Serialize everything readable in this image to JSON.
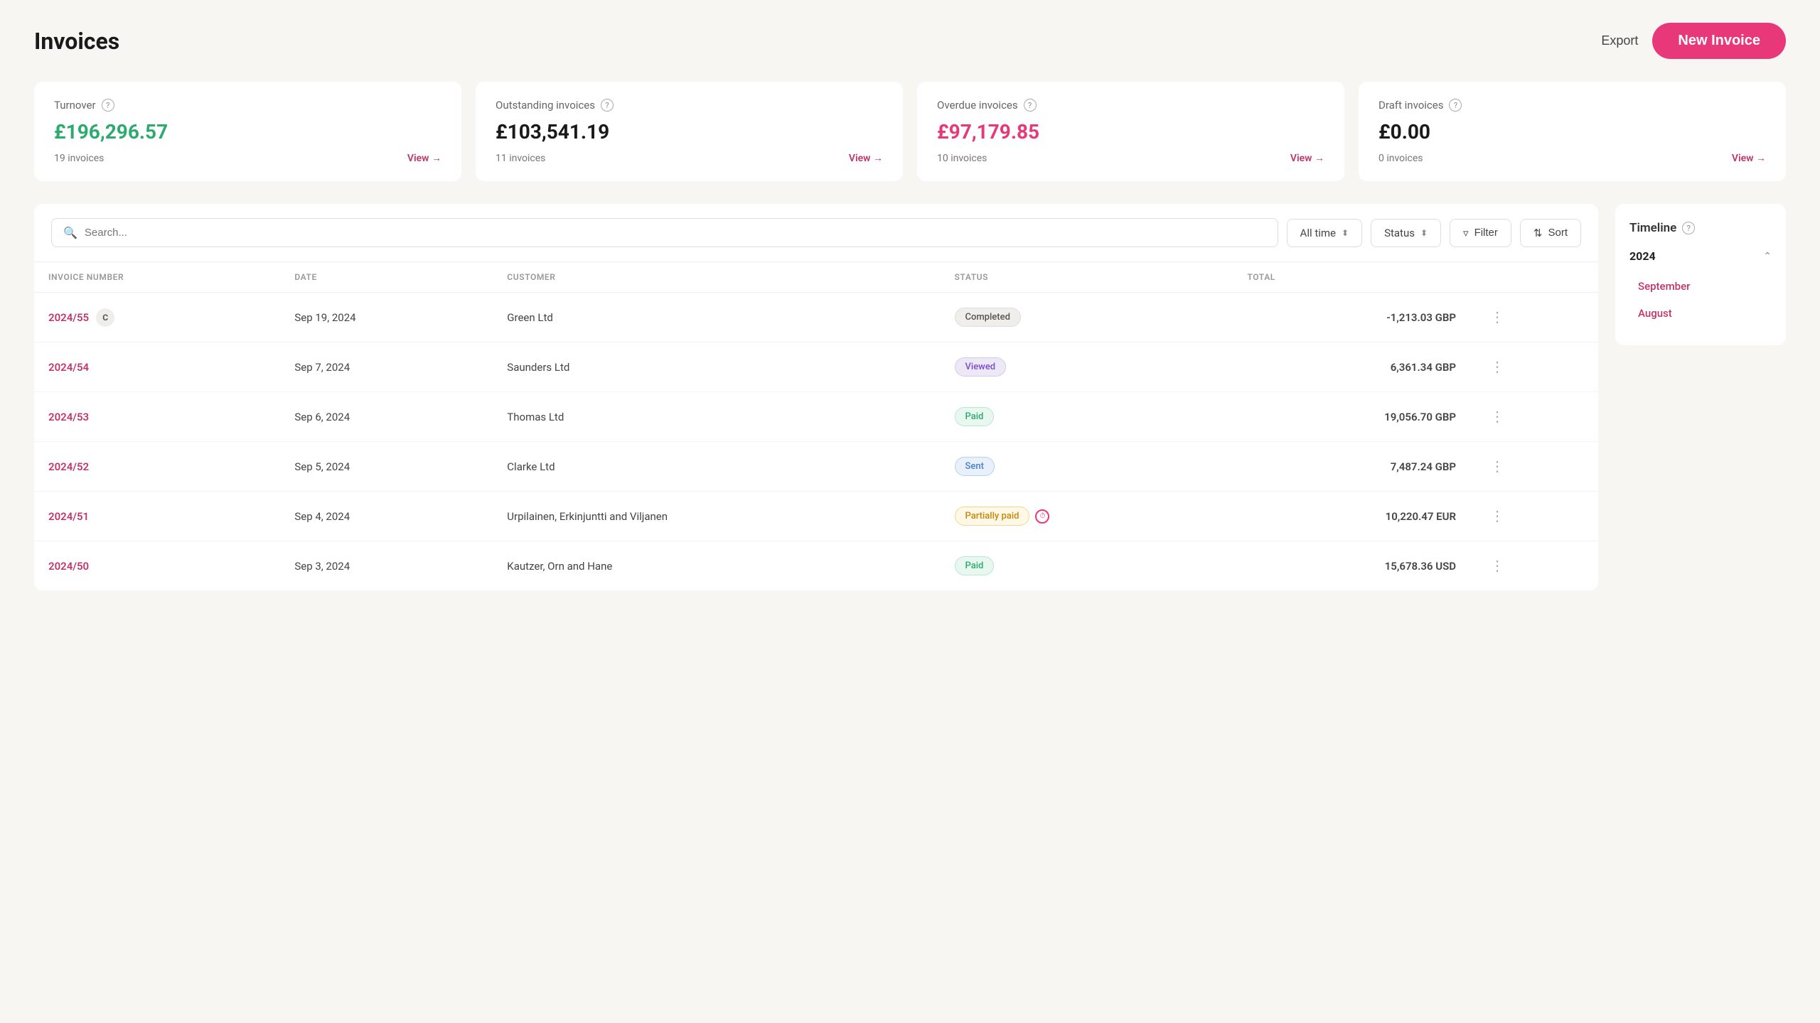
{
  "page": {
    "title": "Invoices"
  },
  "header": {
    "export_label": "Export",
    "new_invoice_label": "New Invoice"
  },
  "summary_cards": [
    {
      "label": "Turnover",
      "amount": "£196,296.57",
      "amount_style": "green",
      "count": "19 invoices",
      "link": "View →"
    },
    {
      "label": "Outstanding invoices",
      "amount": "£103,541.19",
      "amount_style": "black",
      "count": "11 invoices",
      "link": "View →"
    },
    {
      "label": "Overdue invoices",
      "amount": "£97,179.85",
      "amount_style": "red",
      "count": "10 invoices",
      "link": "View →"
    },
    {
      "label": "Draft invoices",
      "amount": "£0.00",
      "amount_style": "black",
      "count": "0 invoices",
      "link": "View →"
    }
  ],
  "toolbar": {
    "search_placeholder": "Search...",
    "time_filter": "All time",
    "status_filter": "Status",
    "filter_label": "Filter",
    "sort_label": "Sort"
  },
  "table": {
    "columns": [
      "INVOICE NUMBER",
      "DATE",
      "CUSTOMER",
      "STATUS",
      "TOTAL"
    ],
    "rows": [
      {
        "invoice_num": "2024/55",
        "has_badge": true,
        "badge": "C",
        "date": "Sep 19, 2024",
        "customer": "Green Ltd",
        "status": "Completed",
        "status_type": "completed",
        "has_clock": false,
        "total": "-1,213.03 GBP"
      },
      {
        "invoice_num": "2024/54",
        "has_badge": false,
        "badge": "",
        "date": "Sep 7, 2024",
        "customer": "Saunders Ltd",
        "status": "Viewed",
        "status_type": "viewed",
        "has_clock": false,
        "total": "6,361.34 GBP"
      },
      {
        "invoice_num": "2024/53",
        "has_badge": false,
        "badge": "",
        "date": "Sep 6, 2024",
        "customer": "Thomas Ltd",
        "status": "Paid",
        "status_type": "paid",
        "has_clock": false,
        "total": "19,056.70 GBP"
      },
      {
        "invoice_num": "2024/52",
        "has_badge": false,
        "badge": "",
        "date": "Sep 5, 2024",
        "customer": "Clarke Ltd",
        "status": "Sent",
        "status_type": "sent",
        "has_clock": false,
        "total": "7,487.24 GBP"
      },
      {
        "invoice_num": "2024/51",
        "has_badge": false,
        "badge": "",
        "date": "Sep 4, 2024",
        "customer": "Urpilainen, Erkinjuntti and Viljanen",
        "status": "Partially paid",
        "status_type": "partial",
        "has_clock": true,
        "total": "10,220.47 EUR"
      },
      {
        "invoice_num": "2024/50",
        "has_badge": false,
        "badge": "",
        "date": "Sep 3, 2024",
        "customer": "Kautzer, Orn and Hane",
        "status": "Paid",
        "status_type": "paid",
        "has_clock": false,
        "total": "15,678.36 USD"
      }
    ]
  },
  "timeline": {
    "title": "Timeline",
    "year": "2024",
    "months": [
      "September",
      "August"
    ]
  }
}
